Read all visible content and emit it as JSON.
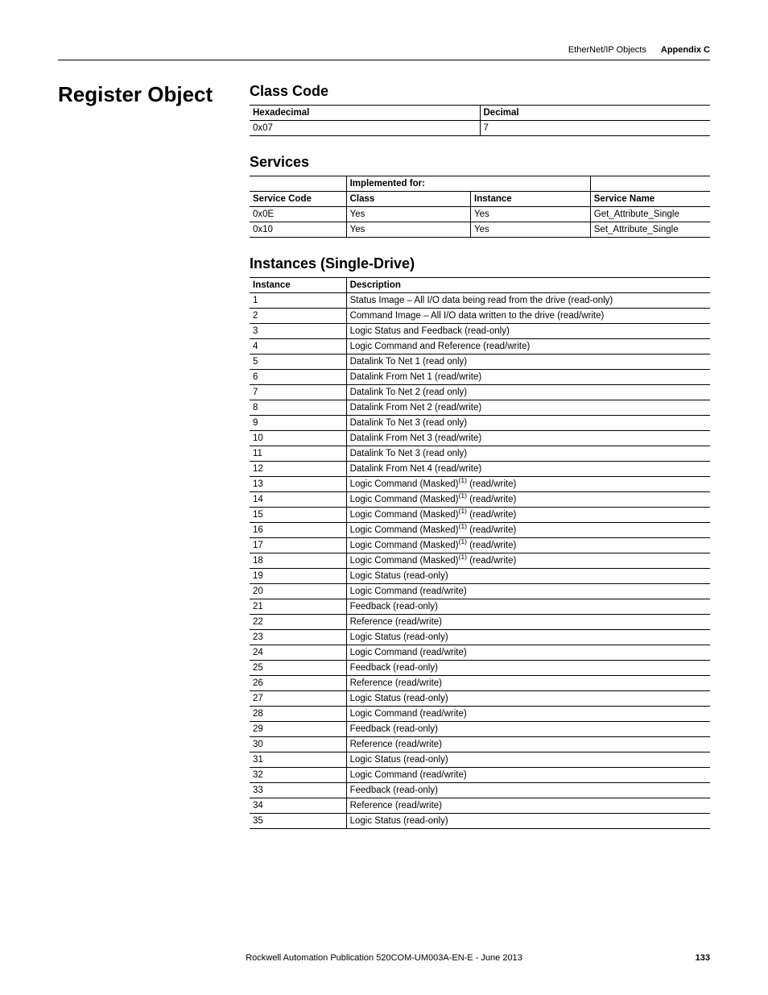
{
  "header": {
    "subject": "EtherNet/IP Objects",
    "appendix": "Appendix C"
  },
  "left": {
    "title": "Register Object"
  },
  "classcode": {
    "heading": "Class Code",
    "headers": [
      "Hexadecimal",
      "Decimal"
    ],
    "rows": [
      {
        "hex": "0x07",
        "dec": "7"
      }
    ]
  },
  "services": {
    "heading": "Services",
    "impl_label": "Implemented for:",
    "headers": {
      "sc": "Service Code",
      "class": "Class",
      "instance": "Instance",
      "name": "Service Name"
    },
    "rows": [
      {
        "sc": "0x0E",
        "class": "Yes",
        "instance": "Yes",
        "name": "Get_Attribute_Single"
      },
      {
        "sc": "0x10",
        "class": "Yes",
        "instance": "Yes",
        "name": "Set_Attribute_Single"
      }
    ]
  },
  "instances": {
    "heading": "Instances (Single-Drive)",
    "headers": {
      "inst": "Instance",
      "desc": "Description"
    },
    "sup": "(1)",
    "rows": [
      {
        "n": "1",
        "d": "Status Image – All I/O data being read from the drive (read-only)"
      },
      {
        "n": "2",
        "d": "Command Image – All I/O data written to the drive (read/write)"
      },
      {
        "n": "3",
        "d": "Logic Status and Feedback (read-only)"
      },
      {
        "n": "4",
        "d": "Logic Command and Reference (read/write)"
      },
      {
        "n": "5",
        "d": "Datalink To Net 1 (read only)"
      },
      {
        "n": "6",
        "d": "Datalink From Net 1 (read/write)"
      },
      {
        "n": "7",
        "d": "Datalink To Net 2 (read only)"
      },
      {
        "n": "8",
        "d": "Datalink From Net 2 (read/write)"
      },
      {
        "n": "9",
        "d": "Datalink To Net 3 (read only)"
      },
      {
        "n": "10",
        "d": "Datalink From Net 3 (read/write)"
      },
      {
        "n": "11",
        "d": "Datalink To Net 3 (read only)"
      },
      {
        "n": "12",
        "d": "Datalink From Net 4 (read/write)"
      },
      {
        "n": "13",
        "d_pre": "Logic Command (Masked)",
        "sup": true,
        "d_post": " (read/write)"
      },
      {
        "n": "14",
        "d_pre": "Logic Command (Masked)",
        "sup": true,
        "d_post": " (read/write)"
      },
      {
        "n": "15",
        "d_pre": "Logic Command (Masked)",
        "sup": true,
        "d_post": " (read/write)"
      },
      {
        "n": "16",
        "d_pre": "Logic Command (Masked)",
        "sup": true,
        "d_post": " (read/write)"
      },
      {
        "n": "17",
        "d_pre": "Logic Command (Masked)",
        "sup": true,
        "d_post": " (read/write)"
      },
      {
        "n": "18",
        "d_pre": "Logic Command (Masked)",
        "sup": true,
        "d_post": " (read/write)"
      },
      {
        "n": "19",
        "d": "Logic Status (read-only)"
      },
      {
        "n": "20",
        "d": "Logic Command (read/write)"
      },
      {
        "n": "21",
        "d": "Feedback (read-only)"
      },
      {
        "n": "22",
        "d": "Reference (read/write)"
      },
      {
        "n": "23",
        "d": "Logic Status (read-only)"
      },
      {
        "n": "24",
        "d": "Logic Command (read/write)"
      },
      {
        "n": "25",
        "d": "Feedback (read-only)"
      },
      {
        "n": "26",
        "d": "Reference (read/write)"
      },
      {
        "n": "27",
        "d": "Logic Status (read-only)"
      },
      {
        "n": "28",
        "d": "Logic Command (read/write)"
      },
      {
        "n": "29",
        "d": "Feedback (read-only)"
      },
      {
        "n": "30",
        "d": "Reference (read/write)"
      },
      {
        "n": "31",
        "d": "Logic Status (read-only)"
      },
      {
        "n": "32",
        "d": "Logic Command (read/write)"
      },
      {
        "n": "33",
        "d": "Feedback (read-only)"
      },
      {
        "n": "34",
        "d": "Reference (read/write)"
      },
      {
        "n": "35",
        "d": "Logic Status (read-only)"
      }
    ]
  },
  "footer": {
    "pub": "Rockwell Automation Publication 520COM-UM003A-EN-E - June 2013",
    "page": "133"
  }
}
